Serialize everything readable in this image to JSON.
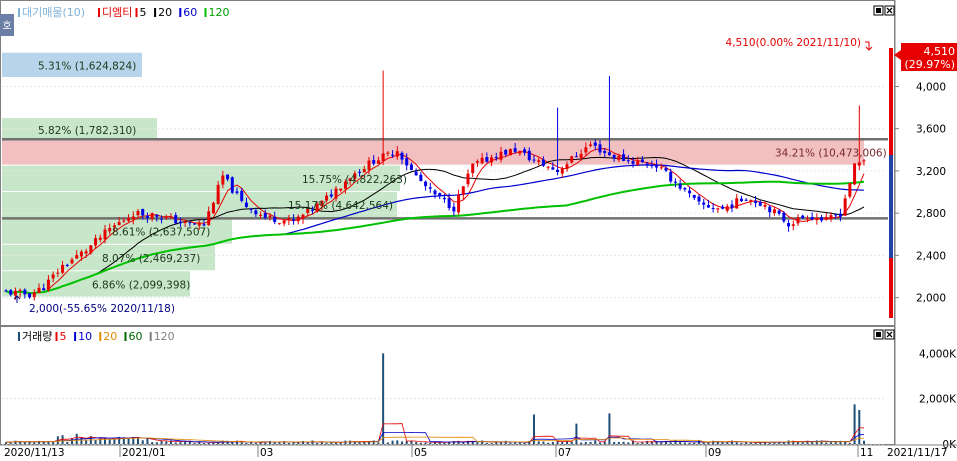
{
  "legend_top": [
    {
      "label": "대기매물(10)",
      "color": "#7fb2d8",
      "marker": "#7fb2d8"
    },
    {
      "label": "디엠티",
      "color": "#e60000",
      "marker": "#e60000"
    },
    {
      "label": "5",
      "color": "#000000",
      "marker": "#e60000"
    },
    {
      "label": "20",
      "color": "#000000",
      "marker": "#000000"
    },
    {
      "label": "60",
      "color": "#0000cc",
      "marker": "#0000cc"
    },
    {
      "label": "120",
      "color": "#00a000",
      "marker": "#00c000"
    }
  ],
  "legend_bottom": [
    {
      "label": "거래량",
      "color": "#000000",
      "marker": "#1f4e79"
    },
    {
      "label": "5",
      "color": "#e60000",
      "marker": "#e60000"
    },
    {
      "label": "10",
      "color": "#0000cc",
      "marker": "#0000cc"
    },
    {
      "label": "20",
      "color": "#e08a00",
      "marker": "#e08a00"
    },
    {
      "label": "60",
      "color": "#006400",
      "marker": "#006400"
    },
    {
      "label": "120",
      "color": "#808080",
      "marker": "#808080"
    }
  ],
  "left_tab_label": "호",
  "price_axis": {
    "ticks": [
      "4,000",
      "3,600",
      "3,200",
      "2,800",
      "2,400",
      "2,000"
    ]
  },
  "volume_axis": {
    "ticks": [
      "4,000K",
      "2,000K",
      "0K"
    ]
  },
  "date_axis": {
    "start": "2020/11/13",
    "labels": [
      "2021/01",
      "03",
      "05",
      "07",
      "09",
      "11"
    ],
    "end": "2021/11/17"
  },
  "current_price": {
    "value": "4,510",
    "change": "(29.97%)"
  },
  "annotations": {
    "high": "4,510(0.00% 2021/11/10)",
    "low": "2,000(-55.65% 2020/11/18)"
  },
  "chart_data": {
    "type": "candlestick",
    "price_ylim": [
      1750,
      4800
    ],
    "volume_ylim": [
      0,
      4500
    ],
    "horizontal_lines": [
      3500,
      2750
    ],
    "volume_profile": [
      {
        "range": [
          4080,
          4320
        ],
        "label": "5.31% (1,624,824)",
        "color": "#b8d4ea"
      },
      {
        "range": [
          3500,
          3700
        ],
        "label": "5.82% (1,782,310)",
        "color": "#c8e6c9"
      },
      {
        "range": [
          3250,
          3500
        ],
        "label": "34.21% (10,473,006)",
        "color": "#f2c0c0"
      },
      {
        "range": [
          3000,
          3250
        ],
        "label": "15.75% (4,822,263)",
        "color": "#c8e6c9"
      },
      {
        "range": [
          2750,
          3000
        ],
        "label": "15.17% (4,642,564)",
        "color": "#c8e6c9"
      },
      {
        "range": [
          2500,
          2750
        ],
        "label": "8.61% (2,637,507)",
        "color": "#c8e6c9"
      },
      {
        "range": [
          2250,
          2500
        ],
        "label": "8.07% (2,469,237)",
        "color": "#c8e6c9"
      },
      {
        "range": [
          2000,
          2250
        ],
        "label": "6.86% (2,099,398)",
        "color": "#c8e6c9"
      }
    ],
    "close_anchors": [
      [
        0,
        2050
      ],
      [
        3,
        2040
      ],
      [
        5,
        2030
      ],
      [
        8,
        2100
      ],
      [
        12,
        2300
      ],
      [
        17,
        2450
      ],
      [
        22,
        2650
      ],
      [
        27,
        2800
      ],
      [
        32,
        2780
      ],
      [
        38,
        2700
      ],
      [
        42,
        2690
      ],
      [
        46,
        3150
      ],
      [
        50,
        2900
      ],
      [
        55,
        2760
      ],
      [
        61,
        2720
      ],
      [
        67,
        2900
      ],
      [
        73,
        3150
      ],
      [
        78,
        3300
      ],
      [
        81,
        3350
      ],
      [
        83,
        3400
      ],
      [
        86,
        3200
      ],
      [
        90,
        3000
      ],
      [
        95,
        2850
      ],
      [
        99,
        3250
      ],
      [
        104,
        3350
      ],
      [
        108,
        3400
      ],
      [
        112,
        3300
      ],
      [
        117,
        3200
      ],
      [
        121,
        3350
      ],
      [
        124,
        3450
      ],
      [
        128,
        3350
      ],
      [
        132,
        3300
      ],
      [
        138,
        3250
      ],
      [
        143,
        3050
      ],
      [
        147,
        2880
      ],
      [
        152,
        2840
      ],
      [
        157,
        2950
      ],
      [
        161,
        2880
      ],
      [
        166,
        2700
      ],
      [
        170,
        2780
      ],
      [
        174,
        2730
      ],
      [
        177,
        2800
      ],
      [
        180,
        3240
      ],
      [
        182,
        3300
      ]
    ],
    "volume_events": [
      [
        80,
        4000
      ],
      [
        112,
        1300
      ],
      [
        128,
        1350
      ],
      [
        180,
        1750
      ]
    ]
  }
}
